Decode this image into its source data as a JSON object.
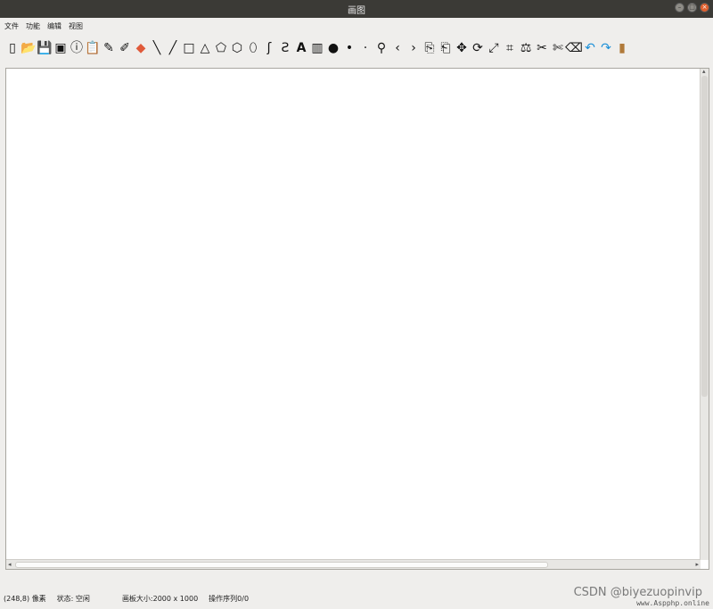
{
  "window": {
    "title": "画图"
  },
  "menu": [
    "文件",
    "功能",
    "编辑",
    "视图"
  ],
  "toolbar": {
    "tools": [
      {
        "name": "new-file-icon",
        "glyph": "▯"
      },
      {
        "name": "open-file-icon",
        "glyph": "📂"
      },
      {
        "name": "save-icon",
        "glyph": "💾"
      },
      {
        "name": "save-as-icon",
        "glyph": "▣"
      },
      {
        "name": "info-icon",
        "glyph": "ⓘ"
      },
      {
        "name": "paste-icon",
        "glyph": "📋"
      },
      {
        "name": "pencil-icon",
        "glyph": "✎"
      },
      {
        "name": "brush-icon",
        "glyph": "✐"
      },
      {
        "name": "eraser-icon",
        "glyph": "◆"
      },
      {
        "name": "line-backslash-icon",
        "glyph": "╲"
      },
      {
        "name": "line-slash-icon",
        "glyph": "╱"
      },
      {
        "name": "rectangle-icon",
        "glyph": "□"
      },
      {
        "name": "triangle-icon",
        "glyph": "△"
      },
      {
        "name": "pentagon-icon",
        "glyph": "⬠"
      },
      {
        "name": "polygon-icon",
        "glyph": "⬡"
      },
      {
        "name": "ellipse-icon",
        "glyph": "⬯"
      },
      {
        "name": "curve-icon",
        "glyph": "ʃ"
      },
      {
        "name": "freeform-icon",
        "glyph": "Ƨ"
      },
      {
        "name": "text-icon",
        "glyph": "A"
      },
      {
        "name": "color-palette-icon",
        "glyph": "▥"
      },
      {
        "name": "large-dot-icon",
        "glyph": "●"
      },
      {
        "name": "medium-dot-icon",
        "glyph": "•"
      },
      {
        "name": "small-dot-icon",
        "glyph": "·"
      },
      {
        "name": "fill-bucket-icon",
        "glyph": "⚲"
      },
      {
        "name": "zoom-in-icon",
        "glyph": "‹"
      },
      {
        "name": "zoom-out-icon",
        "glyph": "›"
      },
      {
        "name": "copy-icon",
        "glyph": "⎘"
      },
      {
        "name": "paste-clip-icon",
        "glyph": "⎗"
      },
      {
        "name": "move-icon",
        "glyph": "✥"
      },
      {
        "name": "rotate-icon",
        "glyph": "⟳"
      },
      {
        "name": "resize-icon",
        "glyph": "⤢"
      },
      {
        "name": "crop-icon",
        "glyph": "⌗"
      },
      {
        "name": "shear-icon",
        "glyph": "⚖"
      },
      {
        "name": "cut-icon",
        "glyph": "✂"
      },
      {
        "name": "scissors-icon",
        "glyph": "✄"
      },
      {
        "name": "clear-icon",
        "glyph": "⌫"
      },
      {
        "name": "undo-icon",
        "glyph": "↶"
      },
      {
        "name": "redo-icon",
        "glyph": "↷"
      },
      {
        "name": "background-icon",
        "glyph": "▮"
      }
    ]
  },
  "colors": {
    "undo": "#1a8fd8",
    "redo": "#1a8fd8",
    "background": "#b07a3a",
    "eraser": "#e05a3a"
  },
  "status": {
    "cursor": "(248,8) 像素",
    "state": "状态: 空闲",
    "canvas_size": "画板大小:2000 x 1000",
    "ops": "操作序列0/0"
  },
  "watermark": {
    "csdn": "CSDN @biyezuopinvip",
    "site": "www.Aspphp.online"
  }
}
